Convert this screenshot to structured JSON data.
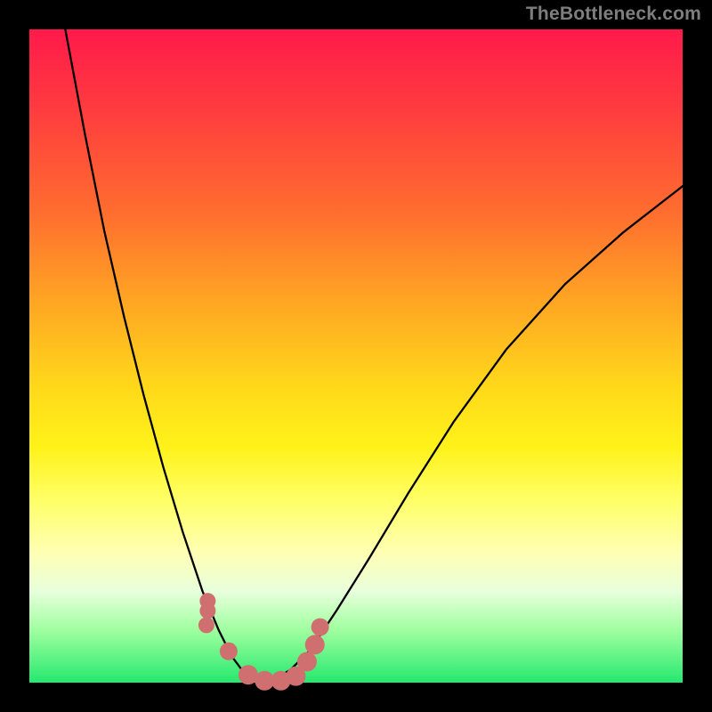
{
  "watermark": "TheBottleneck.com",
  "chart_data": {
    "type": "line",
    "title": "",
    "xlabel": "",
    "ylabel": "",
    "xlim": [
      0,
      1
    ],
    "ylim": [
      0,
      1
    ],
    "series": [
      {
        "name": "bottleneck-curve",
        "x": [
          0.0,
          0.025,
          0.055,
          0.085,
          0.115,
          0.145,
          0.175,
          0.205,
          0.235,
          0.265,
          0.29,
          0.31,
          0.325,
          0.34,
          0.356,
          0.375,
          0.4,
          0.43,
          0.47,
          0.52,
          0.58,
          0.65,
          0.73,
          0.82,
          0.91,
          1.0
        ],
        "values": [
          1.33,
          1.16,
          1.0,
          0.84,
          0.69,
          0.56,
          0.44,
          0.33,
          0.23,
          0.14,
          0.08,
          0.04,
          0.02,
          0.005,
          0.0,
          0.005,
          0.02,
          0.05,
          0.11,
          0.19,
          0.29,
          0.4,
          0.51,
          0.61,
          0.69,
          0.76
        ]
      }
    ],
    "highlight_points": {
      "name": "highlight",
      "color": "#cf6f6f",
      "points": [
        {
          "x": 0.273,
          "y": 0.125,
          "r": 9
        },
        {
          "x": 0.273,
          "y": 0.11,
          "r": 9
        },
        {
          "x": 0.271,
          "y": 0.088,
          "r": 9
        },
        {
          "x": 0.305,
          "y": 0.048,
          "r": 10
        },
        {
          "x": 0.335,
          "y": 0.012,
          "r": 11
        },
        {
          "x": 0.36,
          "y": 0.003,
          "r": 11
        },
        {
          "x": 0.385,
          "y": 0.003,
          "r": 11
        },
        {
          "x": 0.408,
          "y": 0.01,
          "r": 11
        },
        {
          "x": 0.425,
          "y": 0.032,
          "r": 11
        },
        {
          "x": 0.437,
          "y": 0.058,
          "r": 11
        },
        {
          "x": 0.445,
          "y": 0.085,
          "r": 10
        }
      ]
    }
  }
}
